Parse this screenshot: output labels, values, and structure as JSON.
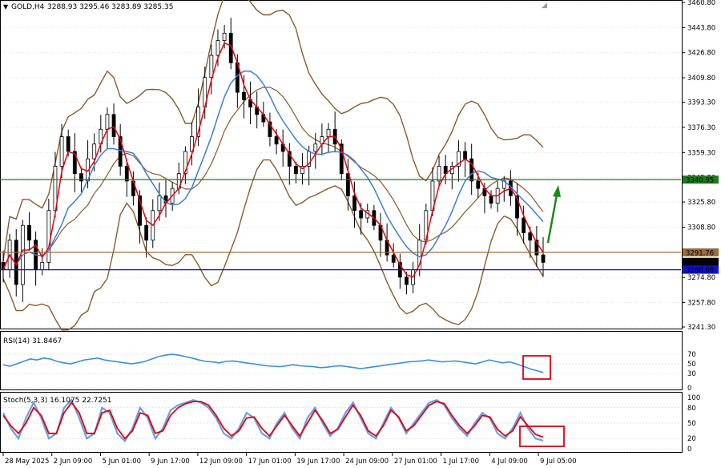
{
  "header": {
    "symbol": "GOLD,H4",
    "ohlc": "3288.93 3295.46 3283.89 3285.35"
  },
  "colors": {
    "candles": "#000000",
    "bollinger": "#8b5a2b",
    "ma_fast": "#e8000b",
    "ma_slow": "#3a7fd5",
    "level_green": "#1f7a1f",
    "level_brown": "#9a6b3a",
    "level_blue": "#1010c8",
    "rsi_line": "#3a8fe0",
    "stoch_main": "#6aa0e0",
    "stoch_signal": "#e00010",
    "arrow": "#1a8a1a",
    "highlight_box": "#e00010",
    "grid": "#c8c8c8"
  },
  "price_axis": {
    "ticks": [
      "3460.80",
      "3443.80",
      "3426.80",
      "3409.80",
      "3393.30",
      "3376.30",
      "3359.30",
      "3342.30",
      "3325.80",
      "3308.80",
      "3291.80",
      "3274.80",
      "3257.80",
      "3241.30"
    ],
    "tags": [
      {
        "label": "3340.95",
        "value": 3340.95,
        "color": "#1f7a1f"
      },
      {
        "label": "3291.76",
        "value": 3291.76,
        "color": "#9a6b3a"
      },
      {
        "label": "3285.35",
        "value": 3285.35,
        "color": "#000000"
      },
      {
        "label": "3280.00",
        "value": 3280.0,
        "color": "#1010c8"
      }
    ]
  },
  "time_axis": [
    "28 May 2025",
    "2 Jun 09:00",
    "5 Jun 01:00",
    "9 Jun 17:00",
    "12 Jun 09:00",
    "17 Jun 01:00",
    "19 Jun 17:00",
    "24 Jun 09:00",
    "27 Jun 01:00",
    "1 Jul 17:00",
    "4 Jul 09:00",
    "9 Jul 05:00"
  ],
  "rsi": {
    "label": "RSI(14) 31.8467",
    "ticks": [
      "70",
      "50",
      "30",
      "0"
    ]
  },
  "stoch": {
    "label": "Stoch(5,3,3) 16.1075 22.7251",
    "ticks": [
      "100",
      "80",
      "50",
      "20",
      "0"
    ]
  },
  "chart_data": [
    {
      "type": "candlestick",
      "title": "GOLD,H4",
      "ylim": [
        3241.3,
        3460.8
      ],
      "close_series": [
        3280,
        3300,
        3270,
        3310,
        3300,
        3280,
        3285,
        3320,
        3350,
        3370,
        3360,
        3345,
        3340,
        3355,
        3365,
        3375,
        3385,
        3370,
        3350,
        3340,
        3330,
        3310,
        3300,
        3320,
        3330,
        3325,
        3335,
        3345,
        3360,
        3370,
        3390,
        3410,
        3425,
        3435,
        3440,
        3420,
        3400,
        3395,
        3390,
        3385,
        3380,
        3370,
        3365,
        3360,
        3350,
        3345,
        3350,
        3360,
        3365,
        3370,
        3375,
        3365,
        3345,
        3330,
        3320,
        3315,
        3320,
        3310,
        3300,
        3290,
        3285,
        3275,
        3270,
        3280,
        3300,
        3320,
        3340,
        3350,
        3345,
        3350,
        3360,
        3355,
        3340,
        3335,
        3330,
        3325,
        3335,
        3340,
        3330,
        3315,
        3305,
        3300,
        3290,
        3285
      ],
      "levels": [
        {
          "name": "resistance",
          "value": 3340.95
        },
        {
          "name": "pivot",
          "value": 3291.76
        },
        {
          "name": "support",
          "value": 3280.0
        }
      ]
    },
    {
      "type": "line",
      "title": "RSI(14) 31.8467",
      "ylim": [
        0,
        100
      ],
      "values": [
        48,
        45,
        50,
        55,
        60,
        58,
        62,
        60,
        55,
        52,
        50,
        54,
        58,
        60,
        62,
        58,
        56,
        54,
        52,
        50,
        52,
        55,
        60,
        65,
        68,
        70,
        68,
        65,
        62,
        58,
        55,
        54,
        52,
        55,
        56,
        54,
        52,
        50,
        48,
        46,
        45,
        44,
        46,
        48,
        46,
        45,
        44,
        42,
        43,
        45,
        46,
        44,
        42,
        40,
        42,
        44,
        46,
        48,
        50,
        52,
        54,
        55,
        56,
        58,
        56,
        54,
        55,
        56,
        54,
        52,
        50,
        54,
        58,
        55,
        52,
        54,
        50,
        45,
        40,
        36,
        32
      ]
    },
    {
      "type": "line",
      "title": "Stoch(5,3,3) 16.1075 22.7251",
      "ylim": [
        0,
        100
      ],
      "series": [
        {
          "name": "main",
          "values": [
            70,
            40,
            20,
            60,
            90,
            60,
            20,
            30,
            80,
            95,
            60,
            20,
            30,
            80,
            70,
            30,
            15,
            40,
            80,
            60,
            20,
            40,
            75,
            85,
            90,
            95,
            90,
            80,
            60,
            30,
            20,
            40,
            70,
            60,
            30,
            20,
            50,
            70,
            40,
            20,
            60,
            80,
            50,
            25,
            40,
            70,
            90,
            60,
            30,
            20,
            50,
            80,
            60,
            30,
            50,
            70,
            90,
            95,
            85,
            60,
            40,
            25,
            50,
            70,
            60,
            30,
            20,
            40,
            70,
            40,
            20,
            16
          ]
        },
        {
          "name": "signal",
          "values": [
            65,
            45,
            30,
            50,
            80,
            65,
            30,
            30,
            70,
            90,
            70,
            30,
            30,
            70,
            75,
            40,
            20,
            35,
            70,
            65,
            30,
            35,
            65,
            80,
            88,
            92,
            92,
            85,
            65,
            40,
            25,
            35,
            60,
            62,
            40,
            25,
            45,
            65,
            45,
            25,
            50,
            75,
            55,
            30,
            38,
            62,
            85,
            65,
            35,
            25,
            45,
            75,
            62,
            35,
            45,
            65,
            85,
            92,
            88,
            65,
            45,
            30,
            45,
            65,
            62,
            38,
            25,
            35,
            62,
            45,
            28,
            22.7
          ]
        }
      ]
    }
  ]
}
